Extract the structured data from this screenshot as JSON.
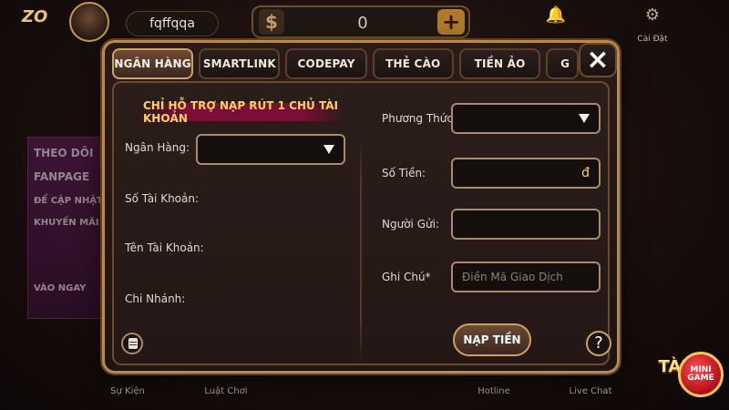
{
  "topbar": {
    "logo_text": "ZO",
    "username": "fqffqqa",
    "balance": {
      "currency_icon": "$",
      "amount": "0",
      "add_icon": "+"
    },
    "settings_label": "Cài Đặt"
  },
  "side_banner": {
    "line1": "THEO DÕI",
    "line2": "FANPAGE",
    "line3": "ĐỂ CẬP NHẬT",
    "line4": "KHUYẾN MÃI",
    "cta": "VÀO NGAY"
  },
  "bottombar": {
    "items": [
      "Sự Kiện",
      "Luật Chơi",
      "Hotline",
      "Live Chat"
    ],
    "mini_game_top": "TÀI",
    "mini_game_label": "MINI GAME"
  },
  "modal": {
    "tabs": [
      "NGÂN HÀNG",
      "SMARTLINK",
      "CODEPAY",
      "THẺ CÀO",
      "TIỀN ẢO",
      "G"
    ],
    "active_tab": "NGÂN HÀNG",
    "close_label": "×",
    "notice": "CHỈ HỖ TRỢ NẠP RÚT 1 CHỦ TÀI KHOẢN",
    "left": {
      "bank_label": "Ngân Hàng:",
      "account_number_label": "Số Tài Khoản:",
      "account_name_label": "Tên Tài Khoản:",
      "branch_label": "Chi Nhánh:"
    },
    "right": {
      "method_label": "Phương Thức:",
      "amount_label": "Số Tiền:",
      "amount_suffix": "đ",
      "sender_label": "Người Gửi:",
      "note_label": "Ghi Chú*",
      "note_placeholder": "Điền Mã Giao Dịch",
      "submit_label": "NẠP TIỀN",
      "help_label": "?"
    }
  },
  "colors": {
    "accent_gold": "#d0a25d",
    "notice_text": "#ffd35b",
    "notice_bg": "#880c38"
  }
}
